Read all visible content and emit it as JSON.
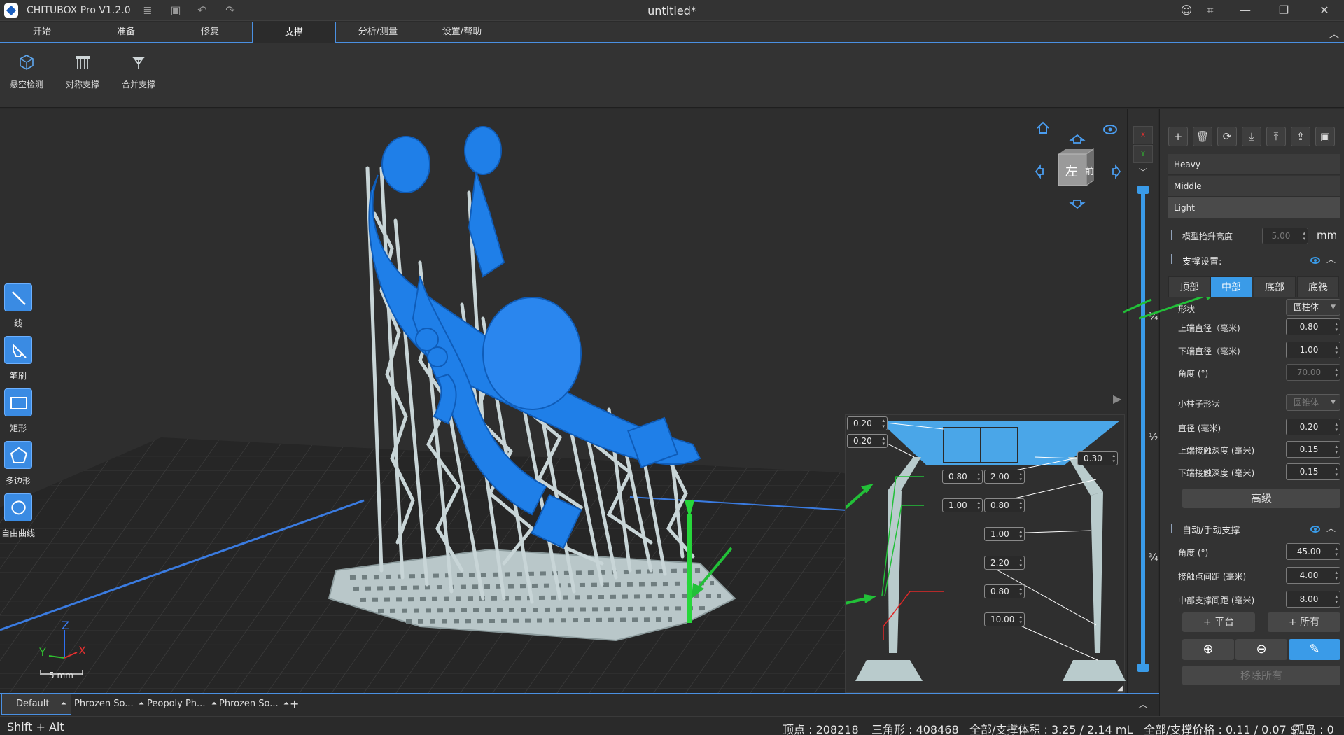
{
  "titlebar": {
    "app_name": "CHITUBOX Pro V1.2.0",
    "doc_title": "untitled*"
  },
  "menu": {
    "tabs": [
      "开始",
      "准备",
      "修复",
      "支撑",
      "分析/测量",
      "设置/帮助"
    ],
    "active": "支撑"
  },
  "ribbon": {
    "buttons": [
      "悬空检测",
      "对称支撑",
      "合并支撑"
    ]
  },
  "left_tools": [
    "线",
    "笔刷",
    "矩形",
    "多边形",
    "自由曲线"
  ],
  "viewcube": {
    "front": "左",
    "side": "前"
  },
  "scale_bar": "5 mm",
  "axes": {
    "x": "X",
    "y": "Y",
    "z": "Z"
  },
  "inset": {
    "values": [
      "0.20",
      "0.20",
      "0.30",
      "0.80",
      "2.00",
      "1.00",
      "0.80",
      "1.00",
      "2.20",
      "0.80",
      "10.00"
    ]
  },
  "slider": {
    "axis_x": "X",
    "axis_y": "Y",
    "fractions": [
      "¼",
      "½",
      "¾"
    ]
  },
  "panel": {
    "presets": [
      "Heavy",
      "Middle",
      "Light"
    ],
    "selected_preset": "Light",
    "lift_height": {
      "label": "模型抬升高度",
      "value": "5.00",
      "unit": "mm"
    },
    "support_settings": {
      "title": "支撑设置:",
      "subtabs": [
        "顶部",
        "中部",
        "底部",
        "底筏"
      ],
      "active_subtab": "中部",
      "shape_label": "形状",
      "shape_value": "圆柱体",
      "top_diameter": {
        "label": "上端直径（毫米)",
        "value": "0.80"
      },
      "bottom_diameter": {
        "label": "下端直径（毫米)",
        "value": "1.00"
      },
      "angle": {
        "label": "角度 (°)",
        "value": "70.00"
      },
      "small_pillar_shape": {
        "label": "小柱子形状",
        "value": "圆锥体"
      },
      "diameter": {
        "label": "直径 (毫米)",
        "value": "0.20"
      },
      "top_depth": {
        "label": "上端接触深度 (毫米)",
        "value": "0.15"
      },
      "bottom_depth": {
        "label": "下端接触深度 (毫米)",
        "value": "0.15"
      },
      "advanced": "高级"
    },
    "auto_support": {
      "title": "自动/手动支撑",
      "angle": {
        "label": "角度 (°)",
        "value": "45.00"
      },
      "contact_spacing": {
        "label": "接触点间距 (毫米)",
        "value": "4.00"
      },
      "middle_spacing": {
        "label": "中部支撑间距 (毫米)",
        "value": "8.00"
      },
      "platform_btn": "+ 平台",
      "all_btn": "+ 所有",
      "remove_all": "移除所有"
    }
  },
  "bottom_tabs": [
    "Default",
    "Phrozen So...",
    "Peopoly Ph...",
    "Phrozen So..."
  ],
  "status": {
    "shortcut": "Shift + Alt",
    "vertices": "顶点 : 208218",
    "triangles": "三角形 : 408468",
    "volume": "全部/支撑体积 : 3.25 / 2.14 mL",
    "price": "全部/支撑价格 : 0.11 / 0.07 $",
    "islands": "孤岛 : 0"
  },
  "colors": {
    "accent": "#3a9be8",
    "model": "#1f7fe8",
    "support": "#c7d5d6",
    "arrow": "#22c038"
  }
}
